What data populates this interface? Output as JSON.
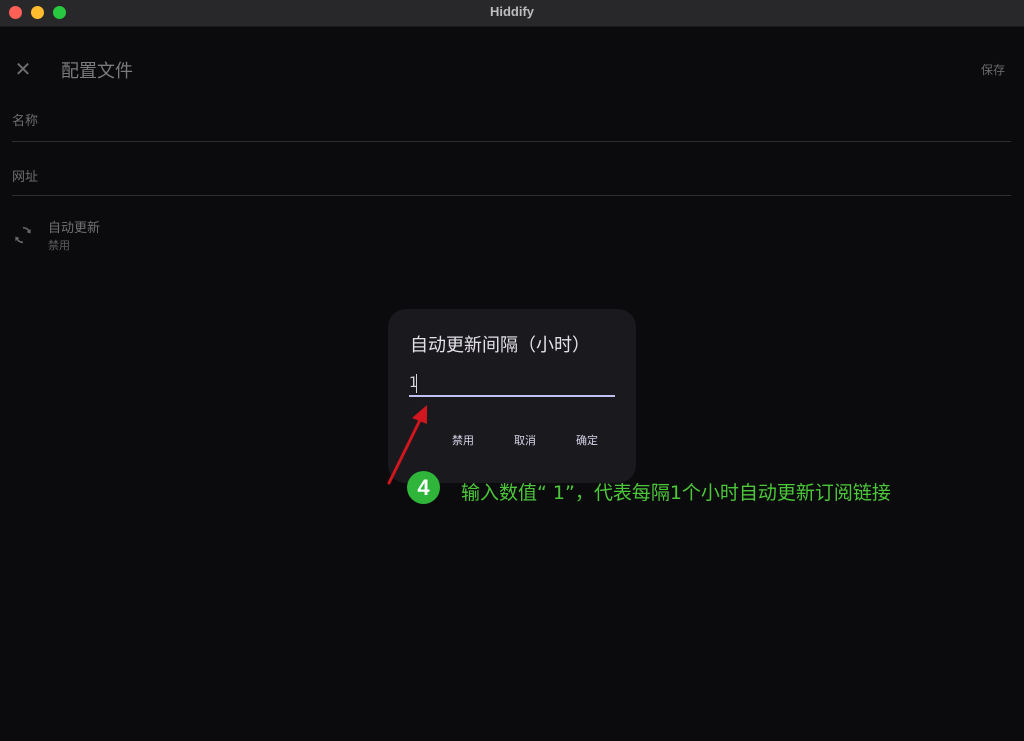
{
  "window": {
    "title": "Hiddify"
  },
  "page": {
    "title": "配置文件",
    "save_label": "保存",
    "name_field_label": "名称",
    "url_field_label": "网址",
    "auto_update": {
      "title": "自动更新",
      "subtitle": "禁用"
    }
  },
  "dialog": {
    "title": "自动更新间隔（小时）",
    "input_value": "1",
    "buttons": {
      "disable": "禁用",
      "cancel": "取消",
      "ok": "确定"
    }
  },
  "annotation": {
    "step": "4",
    "text": "输入数值“ 1”，代表每隔1个小时自动更新订阅链接"
  },
  "colors": {
    "background": "#0b0b0d",
    "dialog_bg": "#1a191d",
    "input_underline": "#bfbff0",
    "annotation_green": "#4cc73a",
    "badge_green": "#2fb53a",
    "arrow_red": "#d0161e"
  },
  "icons": {
    "close": "close-icon",
    "sync": "sync-icon"
  }
}
